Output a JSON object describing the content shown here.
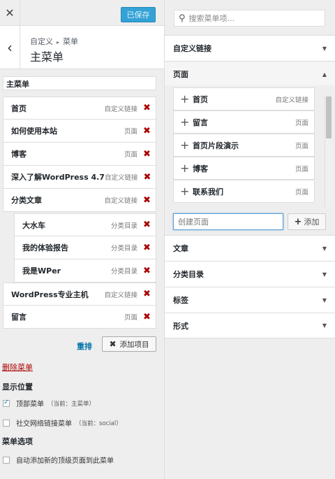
{
  "topbar": {
    "close_icon": "✕",
    "save_label": "已保存"
  },
  "crumb": {
    "parent": "自定义",
    "sep": "▸",
    "current": "菜单",
    "title": "主菜单",
    "back_icon": "‹"
  },
  "menu_name_value": "主菜单",
  "menu_items": [
    {
      "title": "首页",
      "type": "自定义链接"
    },
    {
      "title": "如何使用本站",
      "type": "页面"
    },
    {
      "title": "博客",
      "type": "页面"
    },
    {
      "title": "深入了解WordPress 4.7",
      "type": "自定义链接"
    },
    {
      "title": "分类文章",
      "type": "自定义链接"
    },
    {
      "title": "大水车",
      "type": "分类目录"
    },
    {
      "title": "我的体验报告",
      "type": "分类目录"
    },
    {
      "title": "我是WPer",
      "type": "分类目录"
    },
    {
      "title": "WordPress专业主机",
      "type": "自定义链接"
    },
    {
      "title": "留言",
      "type": "页面"
    }
  ],
  "remove_icon": "✖",
  "actions": {
    "reorder": "重排",
    "add_items": "添加项目",
    "add_items_icon": "✖"
  },
  "delete_menu": "删除菜单",
  "locations": {
    "heading": "显示位置",
    "items": [
      {
        "label": "顶部菜单",
        "note": "（当前：主菜单）",
        "checked": true
      },
      {
        "label": "社交网络链接菜单",
        "note": "（当前：social）",
        "checked": false
      }
    ]
  },
  "options": {
    "heading": "菜单选项",
    "auto_add": "自动添加新的顶级页面到此菜单"
  },
  "search": {
    "icon": "search-icon",
    "placeholder": "搜索菜单项..."
  },
  "accordion": {
    "custom_links": "自定义链接",
    "pages": "页面",
    "posts": "文章",
    "categories": "分类目录",
    "tags": "标签",
    "formats": "形式"
  },
  "pages": [
    {
      "title": "首页",
      "type": "自定义链接"
    },
    {
      "title": "留言",
      "type": "页面"
    },
    {
      "title": "首页片段演示",
      "type": "页面"
    },
    {
      "title": "博客",
      "type": "页面"
    },
    {
      "title": "联系我们",
      "type": "页面"
    }
  ],
  "new_page": {
    "placeholder": "创建页面",
    "add_label": "添加"
  },
  "colors": {
    "accent": "#33a2d6",
    "danger": "#aa0000",
    "link": "#0073aa"
  }
}
